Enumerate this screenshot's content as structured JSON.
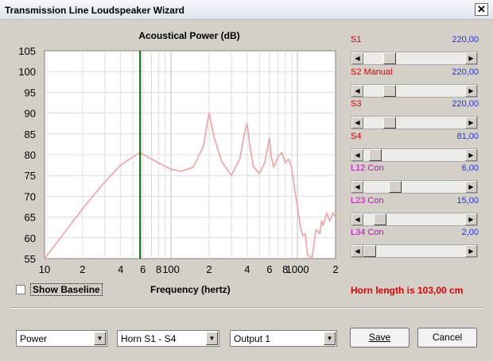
{
  "window": {
    "title": "Transmission Line Loudspeaker Wizard",
    "close_glyph": "✕"
  },
  "chart": {
    "title": "Acoustical Power (dB)",
    "xlabel": "Frequency (hertz)",
    "marker_color": "#006600",
    "curve_color": "#f4a0a0"
  },
  "chart_data": {
    "type": "line",
    "title": "Acoustical Power (dB)",
    "xlabel": "Frequency (hertz)",
    "ylabel": "",
    "x_scale": "log",
    "xlim": [
      10,
      2000
    ],
    "ylim": [
      55,
      105
    ],
    "y_ticks": [
      55,
      60,
      65,
      70,
      75,
      80,
      85,
      90,
      95,
      100,
      105
    ],
    "x_tick_labels": [
      {
        "value": 10,
        "label": "10"
      },
      {
        "value": 20,
        "label": "2"
      },
      {
        "value": 40,
        "label": "4"
      },
      {
        "value": 60,
        "label": "6"
      },
      {
        "value": 80,
        "label": "8"
      },
      {
        "value": 100,
        "label": "100"
      },
      {
        "value": 200,
        "label": "2"
      },
      {
        "value": 400,
        "label": "4"
      },
      {
        "value": 600,
        "label": "6"
      },
      {
        "value": 800,
        "label": "8"
      },
      {
        "value": 1000,
        "label": "1000"
      },
      {
        "value": 2000,
        "label": "2"
      }
    ],
    "marker_x": 57,
    "series": [
      {
        "x": [
          10,
          15,
          20,
          30,
          40,
          50,
          57,
          65,
          80,
          100,
          120,
          150,
          180,
          200,
          220,
          250,
          300,
          350,
          380,
          400,
          420,
          450,
          500,
          550,
          580,
          600,
          620,
          650,
          700,
          750,
          800,
          850,
          900,
          950,
          1000,
          1050,
          1100,
          1150,
          1200,
          1300,
          1400,
          1500,
          1550,
          1600,
          1700,
          1800,
          1900,
          2000
        ],
        "y": [
          55,
          62,
          67,
          73.5,
          77.5,
          79.5,
          80.5,
          79.5,
          78,
          76.5,
          76,
          77,
          82,
          90,
          84,
          78.5,
          75,
          79,
          85,
          87.5,
          82,
          77,
          75.5,
          78,
          81.5,
          84,
          79.5,
          77,
          79.5,
          80.5,
          78,
          79,
          77,
          71.5,
          67.5,
          63,
          60.5,
          61,
          56,
          55,
          62,
          61,
          64,
          63,
          66,
          64,
          66,
          65
        ]
      }
    ]
  },
  "sliders": [
    {
      "label": "S1",
      "value": "220,00",
      "label_color": "#dd0000"
    },
    {
      "label": "S2  Manual",
      "value": "220,00",
      "label_color": "#dd0000"
    },
    {
      "label": "S3",
      "value": "220,00",
      "label_color": "#dd0000"
    },
    {
      "label": "S4",
      "value": "81,00",
      "label_color": "#dd0000"
    },
    {
      "label": "L12  Con",
      "value": "6,00",
      "label_color": "#cc00cc"
    },
    {
      "label": "L23  Con",
      "value": "15,00",
      "label_color": "#cc00cc"
    },
    {
      "label": "L34  Con",
      "value": "2,00",
      "label_color": "#cc00cc"
    }
  ],
  "slider_positions": [
    0.22,
    0.22,
    0.22,
    0.06,
    0.29,
    0.12,
    0.0
  ],
  "scroll_arrows": {
    "left": "◀",
    "right": "▶"
  },
  "baseline": {
    "label": "Show Baseline",
    "checked": false
  },
  "horn_length": "Horn length is 103,00 cm",
  "combos": {
    "view": "Power",
    "horn": "Horn S1 - S4",
    "output": "Output 1",
    "arrow": "▼"
  },
  "buttons": {
    "save": "Save",
    "cancel": "Cancel"
  }
}
